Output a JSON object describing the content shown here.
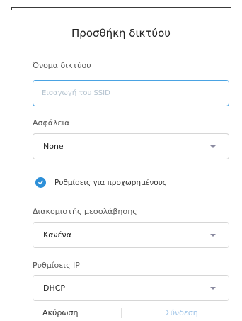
{
  "dialog": {
    "title": "Προσθήκη δικτύου"
  },
  "network_name": {
    "label": "Όνομα δικτύου",
    "value": "",
    "placeholder": "Εισαγωγή του SSID"
  },
  "security": {
    "label": "Ασφάλεια",
    "selected": "None"
  },
  "advanced": {
    "label": "Ρυθμίσεις για προχωρημένους",
    "checked": true
  },
  "proxy": {
    "label": "Διακομιστής μεσολάβησης",
    "selected": "Κανένα"
  },
  "ip_settings": {
    "label": "Ρυθμίσεις IP",
    "selected": "DHCP"
  },
  "footer": {
    "cancel_label": "Ακύρωση",
    "connect_label": "Σύνδεση"
  },
  "colors": {
    "accent": "#2d8fd8",
    "input_border_focus": "#4aa3e3",
    "connect_disabled": "#9fc4e8"
  }
}
